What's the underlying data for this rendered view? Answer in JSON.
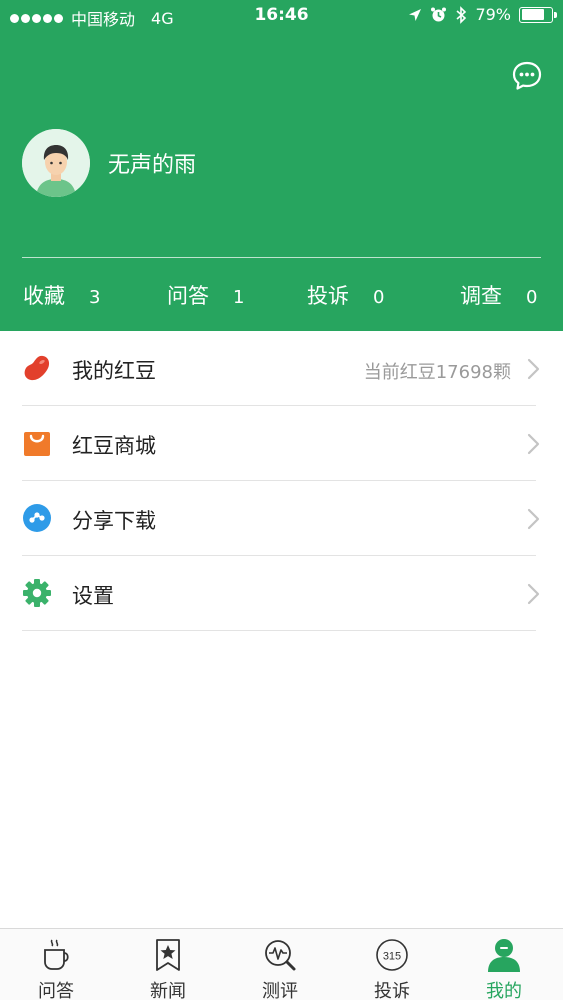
{
  "status_bar": {
    "carrier": "中国移动",
    "network": "4G",
    "time": "16:46",
    "battery": "79%",
    "battery_level": 0.79
  },
  "profile": {
    "username": "无声的雨"
  },
  "stats": [
    {
      "label": "收藏",
      "count": "3"
    },
    {
      "label": "问答",
      "count": "1"
    },
    {
      "label": "投诉",
      "count": "0"
    },
    {
      "label": "调查",
      "count": "0"
    }
  ],
  "menu": [
    {
      "label": "我的红豆",
      "value": "当前红豆17698颗",
      "icon": "red-bean-icon"
    },
    {
      "label": "红豆商城",
      "value": "",
      "icon": "shopping-bag-icon"
    },
    {
      "label": "分享下载",
      "value": "",
      "icon": "share-icon"
    },
    {
      "label": "设置",
      "value": "",
      "icon": "gear-icon"
    }
  ],
  "tabs": [
    {
      "label": "问答",
      "icon": "coffee-cup-icon"
    },
    {
      "label": "新闻",
      "icon": "bookmark-star-icon"
    },
    {
      "label": "测评",
      "icon": "magnifier-pulse-icon"
    },
    {
      "label": "投诉",
      "icon": "badge-315-icon",
      "badge_text": "315"
    },
    {
      "label": "我的",
      "icon": "user-icon",
      "active": true
    }
  ],
  "colors": {
    "brand_green": "#27a55f",
    "text_dark": "#222222",
    "text_muted": "#9a9a9a"
  }
}
